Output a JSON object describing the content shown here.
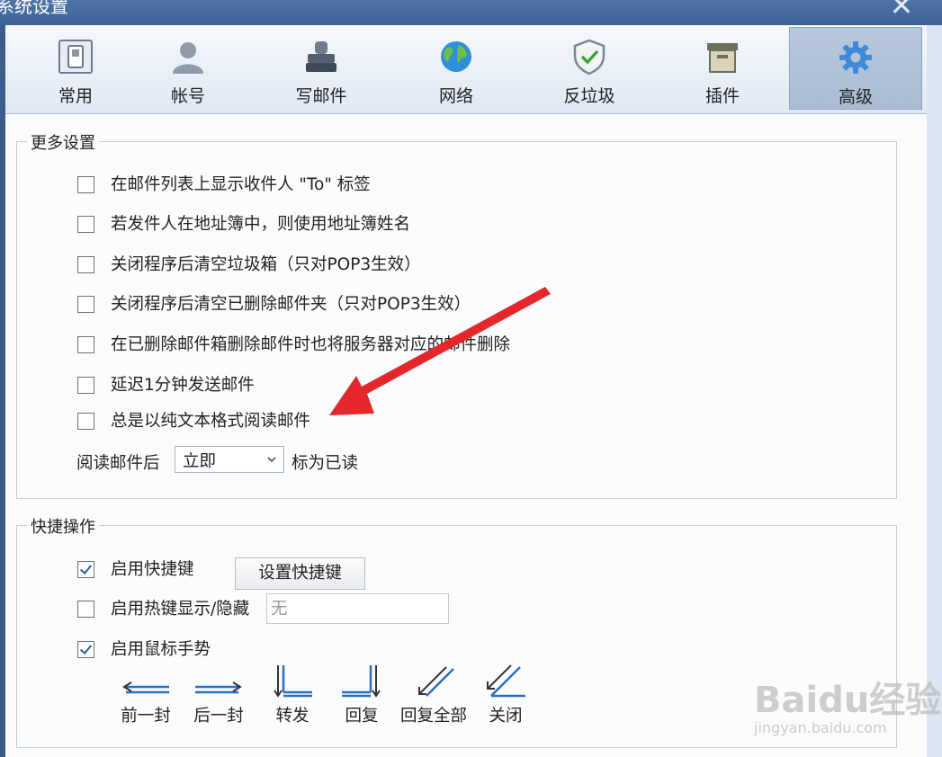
{
  "window": {
    "title": "系统设置"
  },
  "toolbar": {
    "tabs": [
      {
        "label": "常用"
      },
      {
        "label": "帐号"
      },
      {
        "label": "写邮件"
      },
      {
        "label": "网络"
      },
      {
        "label": "反垃圾"
      },
      {
        "label": "插件"
      },
      {
        "label": "高级"
      }
    ]
  },
  "more_settings": {
    "title": "更多设置",
    "options": [
      {
        "label": "在邮件列表上显示收件人 \"To\" 标签",
        "checked": false
      },
      {
        "label": "若发件人在地址簿中，则使用地址簿姓名",
        "checked": false
      },
      {
        "label": "关闭程序后清空垃圾箱（只对POP3生效）",
        "checked": false
      },
      {
        "label": "关闭程序后清空已删除邮件夹（只对POP3生效）",
        "checked": false
      },
      {
        "label": "在已删除邮件箱删除邮件时也将服务器对应的邮件删除",
        "checked": false
      },
      {
        "label": "延迟1分钟发送邮件",
        "checked": false
      },
      {
        "label": "总是以纯文本格式阅读邮件",
        "checked": false
      }
    ],
    "read_prefix": "阅读邮件后",
    "read_select_value": "立即",
    "read_suffix": "标为已读"
  },
  "shortcuts": {
    "title": "快捷操作",
    "enable_hotkeys": {
      "label": "启用快捷键",
      "checked": true
    },
    "set_hotkeys_button": "设置快捷键",
    "enable_show_hide": {
      "label": "启用热键显示/隐藏",
      "checked": false
    },
    "show_hide_value": "无",
    "enable_mouse_gestures": {
      "label": "启用鼠标手势",
      "checked": true
    },
    "gestures": [
      {
        "label": "前一封",
        "icon": "arrow-left-icon"
      },
      {
        "label": "后一封",
        "icon": "arrow-right-icon"
      },
      {
        "label": "转发",
        "icon": "down-right-icon"
      },
      {
        "label": "回复",
        "icon": "down-left-icon"
      },
      {
        "label": "回复全部",
        "icon": "diagonal-left-icon"
      },
      {
        "label": "关闭",
        "icon": "diagonal-close-icon"
      }
    ]
  },
  "watermark": {
    "brand": "Baidu经验",
    "url": "jingyan.baidu.com"
  }
}
